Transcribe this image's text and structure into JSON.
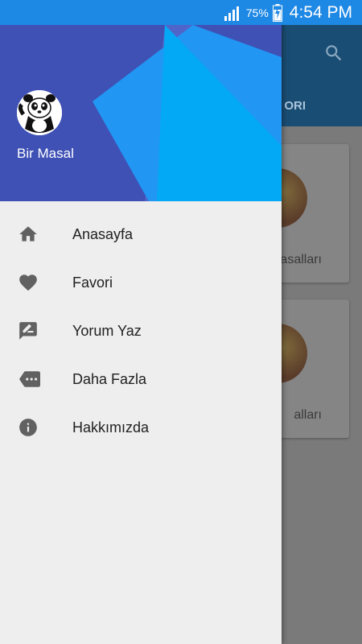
{
  "status_bar": {
    "battery": "75%",
    "time": "4:54 PM"
  },
  "drawer": {
    "app_name": "Bir Masal",
    "items": [
      {
        "label": "Anasayfa",
        "icon": "home-icon"
      },
      {
        "label": "Favori",
        "icon": "heart-icon"
      },
      {
        "label": "Yorum Yaz",
        "icon": "rate-review-icon"
      },
      {
        "label": "Daha Fazla",
        "icon": "more-label-icon"
      },
      {
        "label": "Hakkımızda",
        "icon": "info-icon"
      }
    ]
  },
  "background": {
    "tab_label": "ORI",
    "cards": [
      "asalları",
      "alları"
    ]
  },
  "colors": {
    "status_bar": "#1e88e5",
    "header": "#3f51b5",
    "accent": "#03a9f4"
  }
}
